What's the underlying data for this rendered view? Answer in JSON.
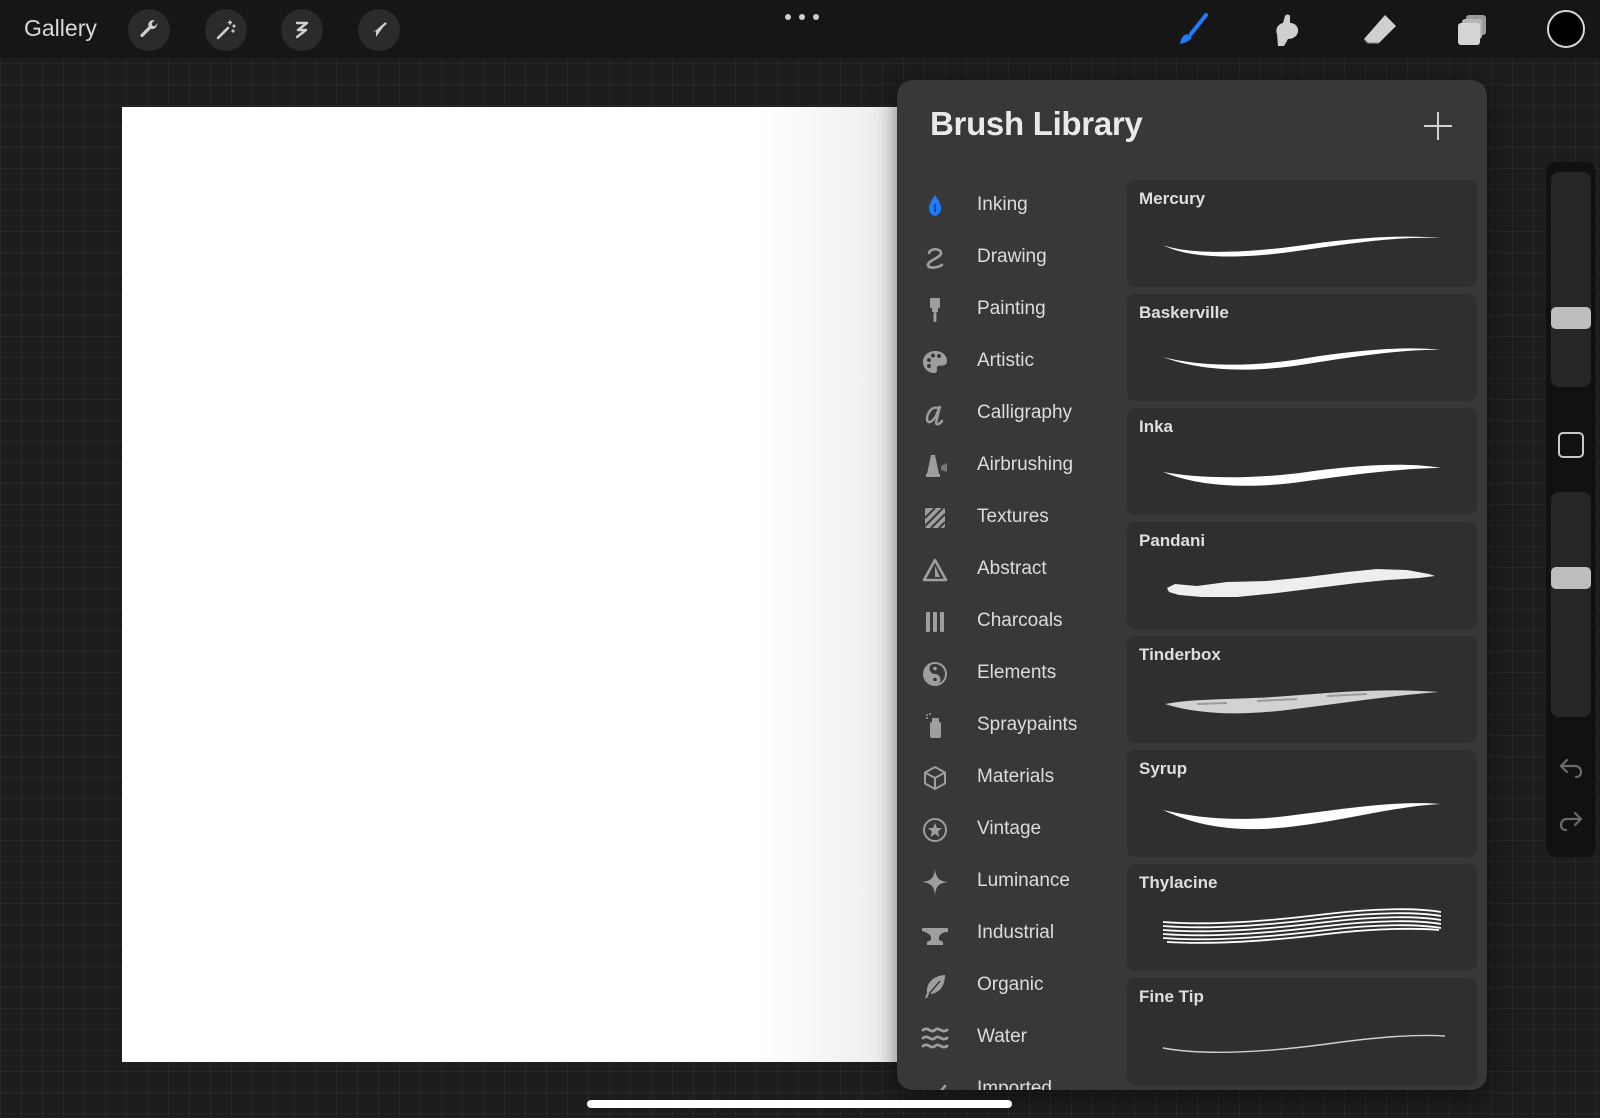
{
  "topbar": {
    "gallery_label": "Gallery",
    "left_tools": [
      "wrench-icon",
      "magic-wand-icon",
      "s-curve-icon",
      "arrow-icon"
    ],
    "right_tools": [
      "brush-icon",
      "smudge-icon",
      "eraser-icon",
      "layers-icon"
    ],
    "active_tool": "brush-icon",
    "accent_color": "#1f7cff",
    "current_color": "#000000"
  },
  "brush_library": {
    "title": "Brush Library",
    "sets": [
      {
        "label": "Inking",
        "icon": "pen-nib-icon",
        "active": true
      },
      {
        "label": "Drawing",
        "icon": "squiggle-icon"
      },
      {
        "label": "Painting",
        "icon": "paint-brush-icon"
      },
      {
        "label": "Artistic",
        "icon": "palette-icon"
      },
      {
        "label": "Calligraphy",
        "icon": "calligraphy-a-icon"
      },
      {
        "label": "Airbrushing",
        "icon": "airbrush-icon"
      },
      {
        "label": "Textures",
        "icon": "texture-hatch-icon"
      },
      {
        "label": "Abstract",
        "icon": "triangle-icon"
      },
      {
        "label": "Charcoals",
        "icon": "charcoal-sticks-icon"
      },
      {
        "label": "Elements",
        "icon": "yin-yang-icon"
      },
      {
        "label": "Spraypaints",
        "icon": "spray-can-icon"
      },
      {
        "label": "Materials",
        "icon": "cube-icon"
      },
      {
        "label": "Vintage",
        "icon": "star-badge-icon"
      },
      {
        "label": "Luminance",
        "icon": "sparkle-icon"
      },
      {
        "label": "Industrial",
        "icon": "anvil-icon"
      },
      {
        "label": "Organic",
        "icon": "leaf-icon"
      },
      {
        "label": "Water",
        "icon": "waves-icon"
      },
      {
        "label": "Imported",
        "icon": "imported-icon"
      }
    ],
    "brushes": [
      {
        "name": "Mercury",
        "stroke": "solid"
      },
      {
        "name": "Baskerville",
        "stroke": "solid"
      },
      {
        "name": "Inka",
        "stroke": "solid"
      },
      {
        "name": "Pandani",
        "stroke": "rough"
      },
      {
        "name": "Tinderbox",
        "stroke": "textured"
      },
      {
        "name": "Syrup",
        "stroke": "solid"
      },
      {
        "name": "Thylacine",
        "stroke": "multiline"
      },
      {
        "name": "Fine Tip",
        "stroke": "thin"
      }
    ]
  },
  "sidebar": {
    "size_level": 0.3,
    "opacity_level": 0.63
  }
}
